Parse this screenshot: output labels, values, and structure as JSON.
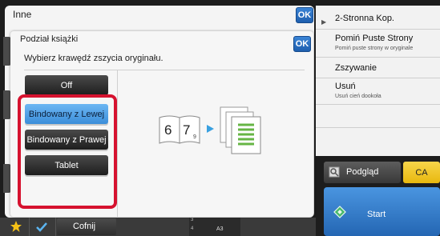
{
  "background_panel": {
    "title": "Inne",
    "ok_label": "OK"
  },
  "right_panel": {
    "items": [
      {
        "label": "2-Stronna Kop.",
        "sublabel": ""
      },
      {
        "label": "Pomiń Puste Strony",
        "sublabel": "Pomiń puste strony w oryginale"
      },
      {
        "label": "Zszywanie",
        "sublabel": ""
      },
      {
        "label": "Usuń",
        "sublabel": "Usuń cień dookoła"
      }
    ]
  },
  "dialog": {
    "title": "Podział książki",
    "ok_label": "OK",
    "instruction": "Wybierz krawędź zszycia oryginału.",
    "options": [
      {
        "label": "Off",
        "selected": false
      },
      {
        "label": "Bindowany z Lewej",
        "selected": true
      },
      {
        "label": "Bindowany z Prawej",
        "selected": false
      },
      {
        "label": "Tablet",
        "selected": false
      }
    ],
    "illustration": {
      "page_numbers": [
        "6",
        "7"
      ],
      "small_number": "9"
    }
  },
  "actions": {
    "preview_label": "Podgląd",
    "ca_label": "CA",
    "start_label": "Start"
  },
  "bottom_bar": {
    "back_label": "Cofnij",
    "paper_label": "A3",
    "tray_numbers": [
      "1",
      "2",
      "3",
      "4"
    ]
  },
  "colors": {
    "accent_blue": "#3c8ed9",
    "highlight_red": "#d6122f",
    "ca_yellow": "#f0c21f",
    "star_yellow": "#f5c116",
    "dark_button": "#2a2a2a"
  }
}
